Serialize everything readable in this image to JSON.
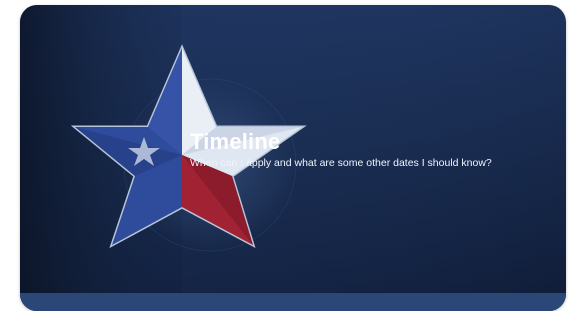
{
  "card": {
    "title": "Timeline",
    "subtitle": "When can I apply and what are some other dates I should know?",
    "icon": "texas-star-icon"
  },
  "colors": {
    "card_background": "#1a2d52",
    "star_blue": "#2e4a9a",
    "star_red": "#9a2230",
    "star_white": "#e8eef6",
    "title_text": "#ffffff"
  }
}
